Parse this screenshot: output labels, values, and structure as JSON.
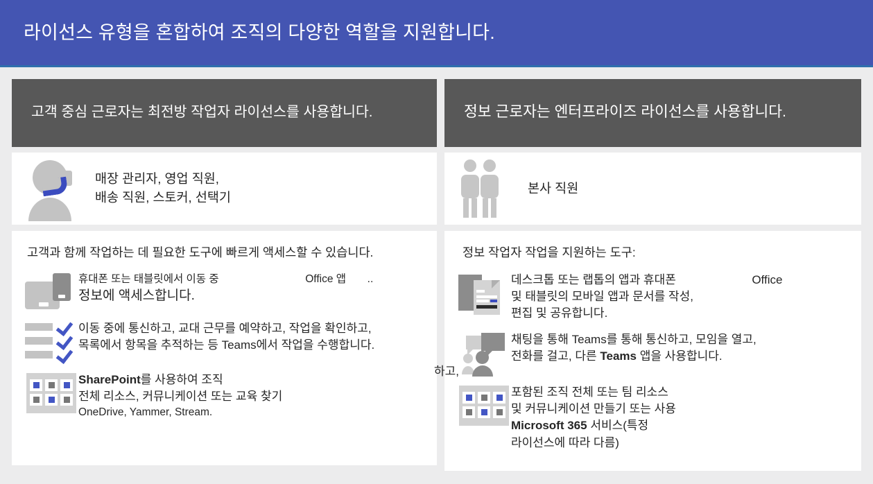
{
  "banner": {
    "title": "라이선스 유형을 혼합하여 조직의 다양한 역할을 지원합니다.",
    "background_color": "#4455b2",
    "rule_color": "#2f6fad"
  },
  "columns": [
    {
      "id": "frontline",
      "header": "고객 중심 근로자는 최전방 작업자 라이선스를 사용합니다.",
      "header_background": "#585858",
      "persona": {
        "icon": "headset-person-icon",
        "label_line1": "매장 관리자, 영업 직원,",
        "label_line2": "배송 직원, 스토커, 선택기"
      },
      "intro": "고객과 함께 작업하는 데 필요한 도구에 빠르게 액세스할 수 있습니다.",
      "features": [
        {
          "icon": "laptop-phone-icon",
          "lines": [
            {
              "text": "휴대폰 또는 태블릿에서 이동 중",
              "size": "small"
            },
            {
              "text": "Office 앱",
              "size": "small",
              "offset": true
            },
            {
              "text": "정보에 액세스합니다.",
              "size": "big"
            }
          ]
        },
        {
          "icon": "checklist-icon",
          "lines": [
            {
              "text": "이동 중에 통신하고, 교대 근무를 예약하고, 작업을 확인하고,",
              "size": "big"
            },
            {
              "text": "목록에서 항목을 추적하는 등 Teams에서 작업을 수행합니다.",
              "size": "big"
            }
          ]
        },
        {
          "icon": "grid-icon",
          "lines": [
            {
              "text": "SharePoint",
              "bold": true,
              "suffix": "를 사용하여 조직",
              "size": "big"
            },
            {
              "text": "전체 리소스, 커뮤니케이션 또는 교육 찾기",
              "size": "big"
            },
            {
              "text": "OneDrive, Yammer, Stream.",
              "size": "small"
            }
          ]
        }
      ]
    },
    {
      "id": "information-worker",
      "header": "정보 근로자는 엔터프라이즈 라이선스를 사용합니다.",
      "header_background": "#585858",
      "persona": {
        "icon": "two-people-icon",
        "label_line1": "본사 직원",
        "label_line2": ""
      },
      "intro": "정보 작업자 작업을 지원하는 도구:",
      "features": [
        {
          "icon": "documents-icon",
          "lines": [
            {
              "text": "데스크톱 또는 랩톱의 앱과 휴대폰",
              "size": "big"
            },
            {
              "text": "Office",
              "size": "big",
              "offset": true
            },
            {
              "text": "및 태블릿의 모바일 앱과 문서를 작성,",
              "size": "big"
            },
            {
              "text": "편집 및 공유합니다.",
              "size": "big"
            }
          ]
        },
        {
          "icon": "chat-icon",
          "lines": [
            {
              "text": "채팅을 통해 Teams를 통해 통신하고, 모임을 열고,",
              "size": "big"
            },
            {
              "text": "전화를 걸고, 다른 ",
              "bold_mid": "Teams",
              "suffix": " 앱을 사용합니다.",
              "size": "big"
            }
          ]
        },
        {
          "icon": "grid-icon",
          "lines": [
            {
              "text": "포함된 조직 전체 또는 팀 리소스",
              "size": "big"
            },
            {
              "text": "및 커뮤니케이션 만들기 또는 사용",
              "size": "big"
            },
            {
              "text": "Microsoft 365",
              "bold": true,
              "suffix": " 서비스(특정",
              "size": "big"
            },
            {
              "text": "라이선스에 따라 다름)",
              "size": "big"
            }
          ]
        }
      ]
    }
  ],
  "fragments": {
    "left_row1_tail": "..",
    "left_row2_overflow": "하고,"
  },
  "colors": {
    "accent_blue": "#4356c4",
    "icon_gray": "#c3c3c3",
    "icon_dark_gray": "#8c8c8c",
    "card_background": "#ffffff",
    "page_background": "#ececed"
  }
}
